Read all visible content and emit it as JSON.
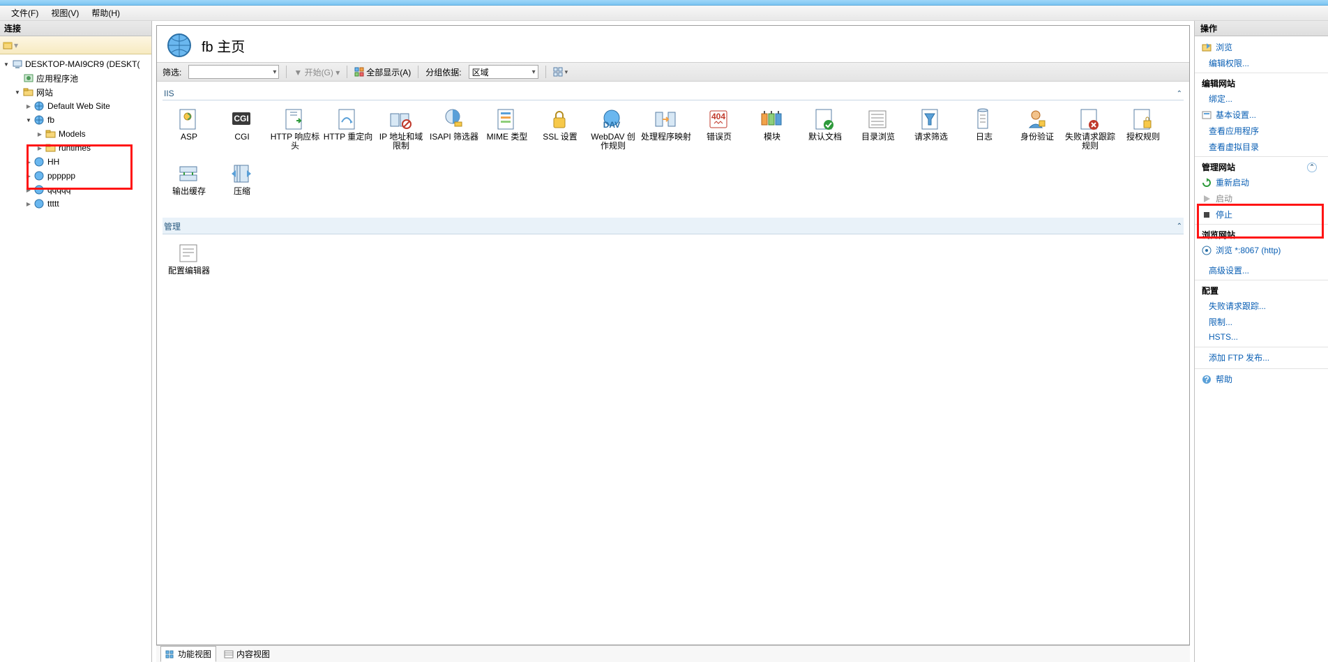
{
  "menubar": {
    "file": "文件(F)",
    "view": "视图(V)",
    "help": "帮助(H)"
  },
  "left": {
    "header": "连接",
    "nodes": {
      "root": "DESKTOP-MAI9CR9 (DESKT(",
      "apppools": "应用程序池",
      "sites": "网站",
      "defaultsite": "Default Web Site",
      "fb": "fb",
      "models": "Models",
      "runtimes": "runtimes",
      "hh": "HH",
      "pppppp": "pppppp",
      "qqqqq": "qqqqq",
      "ttttt": "ttttt"
    }
  },
  "center": {
    "title": "fb 主页",
    "toolbar": {
      "filter_label": "筛选:",
      "go": "开始(G)",
      "showall": "全部显示(A)",
      "groupby_label": "分组依据:",
      "groupby_value": "区域"
    },
    "group_iis": "IIS",
    "group_mgmt": "管理",
    "features_row1": [
      {
        "key": "asp",
        "label": "ASP"
      },
      {
        "key": "cgi",
        "label": "CGI"
      },
      {
        "key": "http-resp",
        "label": "HTTP 响应标头"
      },
      {
        "key": "http-redirect",
        "label": "HTTP 重定向"
      },
      {
        "key": "ipdomain",
        "label": "IP 地址和域限制"
      },
      {
        "key": "isapi",
        "label": "ISAPI 筛选器"
      },
      {
        "key": "mime",
        "label": "MIME 类型"
      },
      {
        "key": "ssl",
        "label": "SSL 设置"
      },
      {
        "key": "webdav",
        "label": "WebDAV 创作规则"
      },
      {
        "key": "handler",
        "label": "处理程序映射"
      },
      {
        "key": "errorpages",
        "label": "错误页"
      },
      {
        "key": "modules",
        "label": "模块"
      },
      {
        "key": "defaultdoc",
        "label": "默认文档"
      },
      {
        "key": "dirbrowse",
        "label": "目录浏览"
      }
    ],
    "features_row2": [
      {
        "key": "reqfilter",
        "label": "请求筛选"
      },
      {
        "key": "logging",
        "label": "日志"
      },
      {
        "key": "auth",
        "label": "身份验证"
      },
      {
        "key": "failedreq",
        "label": "失败请求跟踪规则"
      },
      {
        "key": "authrules",
        "label": "授权规则"
      },
      {
        "key": "outputcache",
        "label": "输出缓存"
      },
      {
        "key": "compression",
        "label": "压缩"
      }
    ],
    "features_mgmt": [
      {
        "key": "configeditor",
        "label": "配置编辑器"
      }
    ],
    "viewtabs": {
      "features": "功能视图",
      "content": "内容视图"
    }
  },
  "right": {
    "header": "操作",
    "browse": "浏览",
    "editperm": "编辑权限...",
    "sec_editsite": "编辑网站",
    "bindings": "绑定...",
    "basicsettings": "基本设置...",
    "viewapps": "查看应用程序",
    "viewvdirs": "查看虚拟目录",
    "sec_managesite": "管理网站",
    "restart": "重新启动",
    "start": "启动",
    "stop": "停止",
    "sec_browsesite": "浏览网站",
    "browse_port": "浏览 *:8067 (http)",
    "advancedsettings": "高级设置...",
    "sec_config": "配置",
    "failedreq": "失败请求跟踪...",
    "limits": "限制...",
    "hsts": "HSTS...",
    "addftp": "添加 FTP 发布...",
    "help": "帮助"
  }
}
